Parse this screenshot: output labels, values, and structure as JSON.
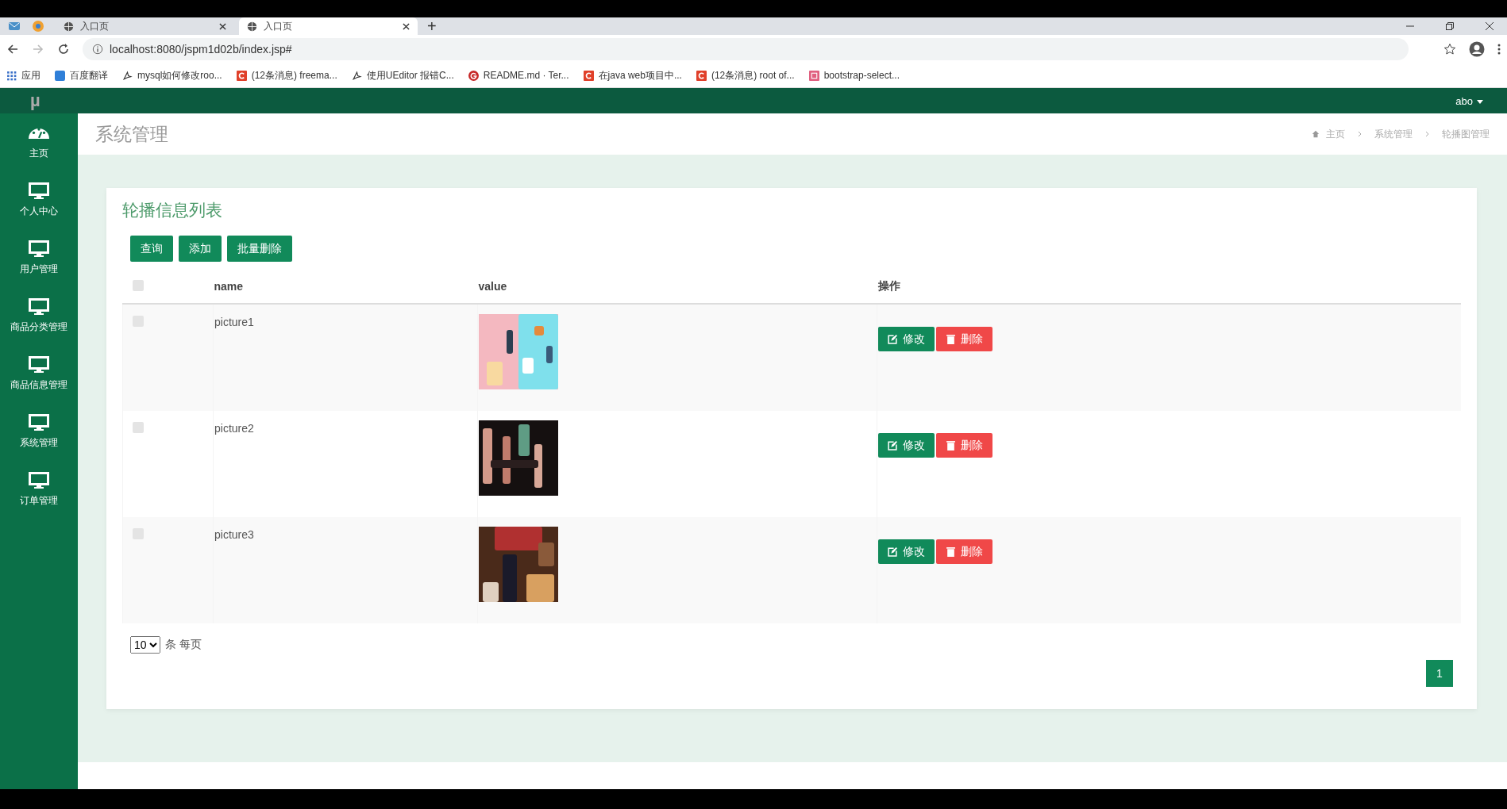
{
  "browser": {
    "tabs": [
      {
        "title": "入口页",
        "selected": false
      },
      {
        "title": "入口页",
        "selected": true
      }
    ],
    "new_tab": "+",
    "url": "localhost:8080/jspm1d02b/index.jsp#",
    "bookmarks": [
      {
        "label": "应用"
      },
      {
        "label": "百度翻译"
      },
      {
        "label": "mysql如何修改roo..."
      },
      {
        "label": "(12条消息) freema..."
      },
      {
        "label": "使用UEditor 报错C..."
      },
      {
        "label": "README.md · Ter..."
      },
      {
        "label": "在java web项目中..."
      },
      {
        "label": "(12条消息) root of..."
      },
      {
        "label": "bootstrap-select..."
      }
    ]
  },
  "header": {
    "logo": "µ",
    "user": "abo"
  },
  "sidebar": {
    "items": [
      {
        "label": "主页"
      },
      {
        "label": "个人中心"
      },
      {
        "label": "用户管理"
      },
      {
        "label": "商品分类管理"
      },
      {
        "label": "商品信息管理"
      },
      {
        "label": "系统管理"
      },
      {
        "label": "订单管理"
      }
    ]
  },
  "page": {
    "title": "系统管理",
    "breadcrumb": [
      "主页",
      "系统管理",
      "轮播图管理"
    ]
  },
  "card": {
    "title": "轮播信息列表",
    "buttons": [
      "查询",
      "添加",
      "批量删除"
    ],
    "table": {
      "select_all": {
        "checked": false
      },
      "columns": [
        "name",
        "value",
        "操作"
      ],
      "rows": [
        {
          "checked": false,
          "name": "picture1",
          "value": {
            "kind": "picture"
          },
          "actions": [
            "修改",
            "删除"
          ]
        },
        {
          "checked": false,
          "name": "picture2",
          "value": {
            "kind": "picture"
          },
          "actions": [
            "修改",
            "删除"
          ]
        },
        {
          "checked": false,
          "name": "picture3",
          "value": {
            "kind": "picture"
          },
          "actions": [
            "修改",
            "删除"
          ]
        }
      ]
    },
    "page_size": {
      "value": "10",
      "label": "条 每页"
    },
    "pagination": [
      {
        "label": "1",
        "selected": true
      }
    ]
  }
}
